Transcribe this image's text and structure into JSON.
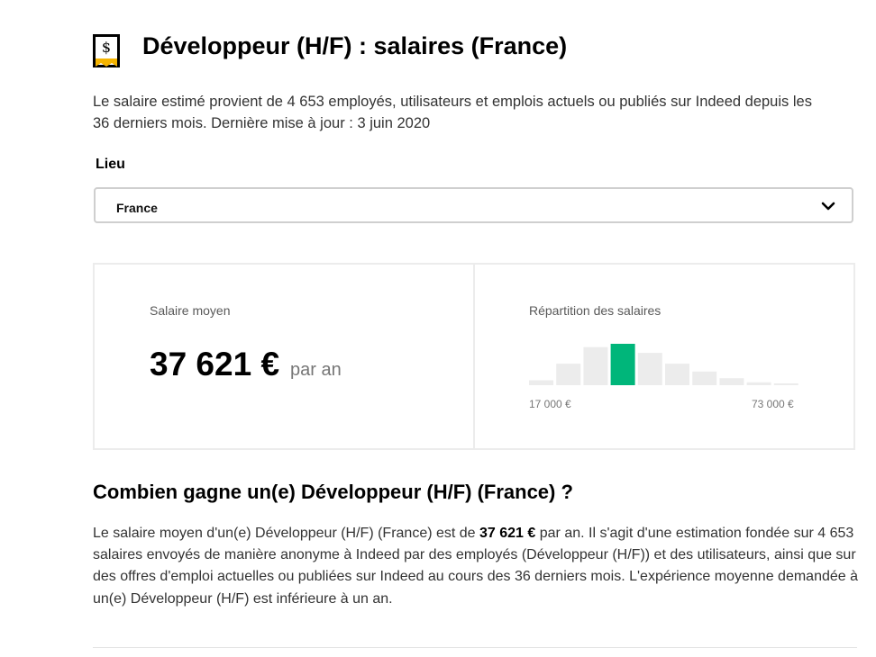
{
  "header": {
    "icon": "salary-receipt-icon",
    "title": "Développeur (H/F) : salaires (France)"
  },
  "intro": {
    "text": "Le salaire estimé provient de 4 653 employés, utilisateurs et emplois actuels ou publiés sur Indeed depuis les 36 derniers mois. Dernière mise à jour : 3 juin 2020"
  },
  "location": {
    "label": "Lieu",
    "selected": "France",
    "icon": "chevron-down-icon"
  },
  "average": {
    "label": "Salaire moyen",
    "value": "37 621 €",
    "period": "par an"
  },
  "distribution": {
    "label": "Répartition des salaires",
    "min_label": "17 000 €",
    "max_label": "73 000 €",
    "bar_levels": [
      0.12,
      0.52,
      0.92,
      1.0,
      0.78,
      0.52,
      0.33,
      0.17,
      0.07,
      0.04
    ],
    "highlight_index": 3,
    "colors": {
      "bar": "#ececec",
      "highlight": "#00b67a"
    }
  },
  "section": {
    "title": "Combien gagne un(e) Développeur (H/F) (France) ?",
    "text_before": "Le salaire moyen d'un(e) Développeur (H/F) (France) est de ",
    "text_bold": "37 621 €",
    "text_after": " par an. Il s'agit d'une estimation fondée sur 4 653 salaires envoyés de manière anonyme à Indeed par des employés (Développeur (H/F)) et des utilisateurs, ainsi que sur des offres d'emploi actuelles ou publiées sur Indeed au cours des 36 derniers mois. L'expérience moyenne demandée à un(e) Développeur (H/F) est inférieure à un an."
  },
  "colors": {
    "accent": "#f5b400",
    "text": "#2d2d2d",
    "highlight": "#00b67a"
  }
}
